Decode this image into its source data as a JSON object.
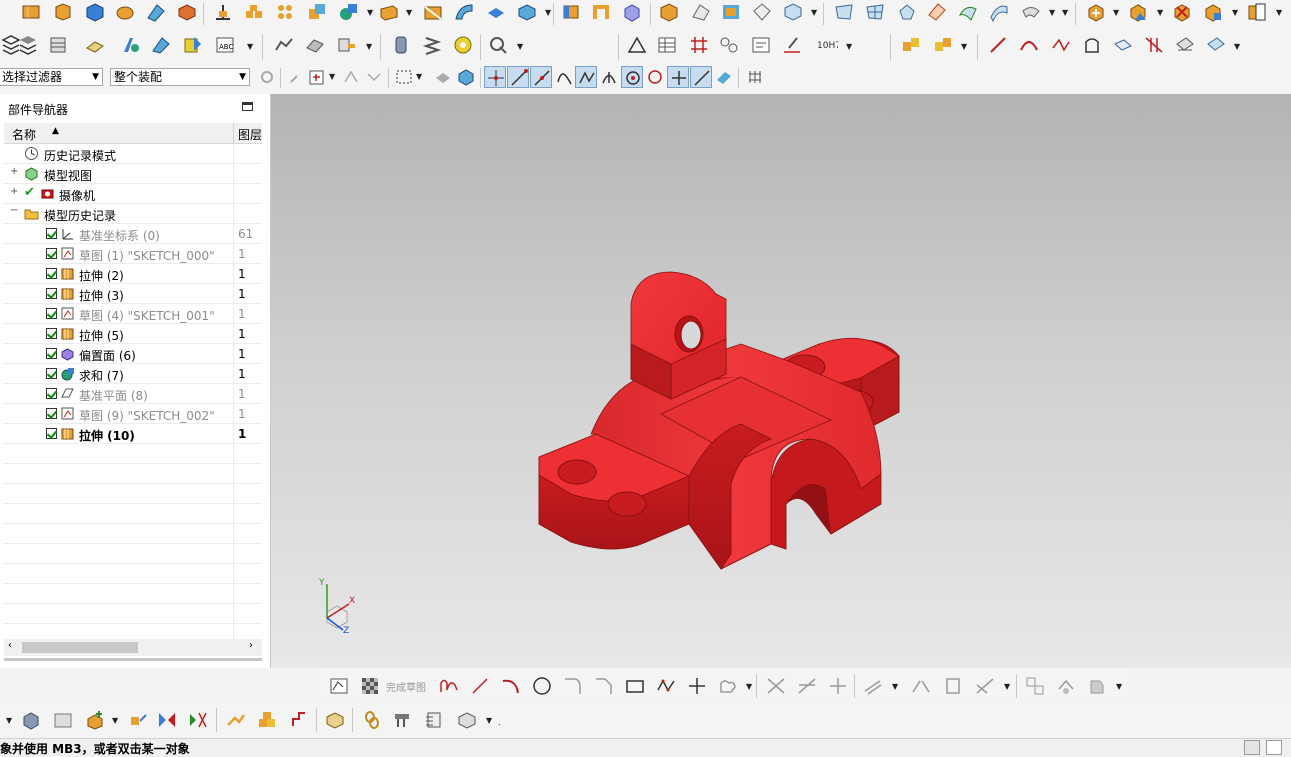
{
  "filters": {
    "selection_filter": "选择过滤器",
    "assembly_scope": "整个装配"
  },
  "navigator": {
    "title": "部件导航器",
    "col_name": "名称",
    "col_layer": "图层",
    "items": [
      {
        "label": "历史记录模式",
        "layer": "",
        "state": "normal",
        "icon": "clock-icon"
      },
      {
        "label": "模型视图",
        "layer": "",
        "state": "normal",
        "icon": "model-view-icon"
      },
      {
        "label": "摄像机",
        "layer": "",
        "state": "normal",
        "icon": "camera-icon"
      },
      {
        "label": "模型历史记录",
        "layer": "",
        "state": "normal",
        "icon": "folder-icon"
      },
      {
        "label": "基准坐标系 (0)",
        "layer": "61",
        "state": "grey",
        "icon": "datum-csys-icon"
      },
      {
        "label": "草图 (1) \"SKETCH_000\"",
        "layer": "1",
        "state": "grey",
        "icon": "sketch-icon"
      },
      {
        "label": "拉伸 (2)",
        "layer": "1",
        "state": "normal",
        "icon": "extrude-icon"
      },
      {
        "label": "拉伸 (3)",
        "layer": "1",
        "state": "normal",
        "icon": "extrude-icon"
      },
      {
        "label": "草图 (4) \"SKETCH_001\"",
        "layer": "1",
        "state": "grey",
        "icon": "sketch-icon"
      },
      {
        "label": "拉伸 (5)",
        "layer": "1",
        "state": "normal",
        "icon": "extrude-icon"
      },
      {
        "label": "偏置面 (6)",
        "layer": "1",
        "state": "normal",
        "icon": "offset-face-icon"
      },
      {
        "label": "求和 (7)",
        "layer": "1",
        "state": "normal",
        "icon": "unite-icon"
      },
      {
        "label": "基准平面 (8)",
        "layer": "1",
        "state": "grey",
        "icon": "datum-plane-icon"
      },
      {
        "label": "草图 (9) \"SKETCH_002\"",
        "layer": "1",
        "state": "grey",
        "icon": "sketch-icon"
      },
      {
        "label": "拉伸 (10)",
        "layer": "1",
        "state": "bold",
        "icon": "extrude-icon"
      }
    ]
  },
  "viewport": {
    "axis_y": "Y",
    "axis_x": "X",
    "axis_z": "Z",
    "model_color": "#e8262a"
  },
  "sketch_toolbar": {
    "finish_sketch": "完成草图"
  },
  "status": {
    "message": "象并使用 MB3，或者双击某一对象"
  }
}
